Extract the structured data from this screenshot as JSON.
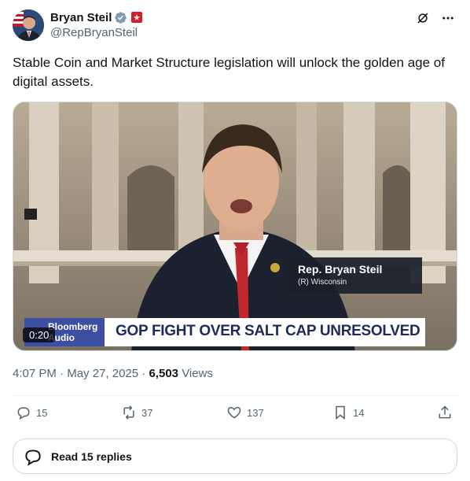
{
  "author": {
    "display_name": "Bryan Steil",
    "handle": "@RepBryanSteil"
  },
  "tweet": {
    "text": "Stable Coin and Market Structure legislation will unlock the golden age of digital assets."
  },
  "video": {
    "duration": "0:20",
    "lower_third_name": "Rep. Bryan Steil",
    "lower_third_sub": "(R) Wisconsin",
    "network_line1": "Bloomberg",
    "network_line2": "Audio",
    "headline": "GOP FIGHT OVER SALT CAP UNRESOLVED"
  },
  "meta": {
    "time": "4:07 PM",
    "sep1": "·",
    "date": "May 27, 2025",
    "sep2": "·",
    "views_count": "6,503",
    "views_label": "Views"
  },
  "actions": {
    "replies": "15",
    "reposts": "37",
    "likes": "137",
    "bookmarks": "14"
  },
  "read_replies": {
    "label": "Read 15 replies"
  },
  "colors": {
    "text": "#0f1419",
    "muted": "#536471",
    "verified": "#829aab",
    "gov_red": "#d0202e",
    "border": "#cfd9de"
  }
}
